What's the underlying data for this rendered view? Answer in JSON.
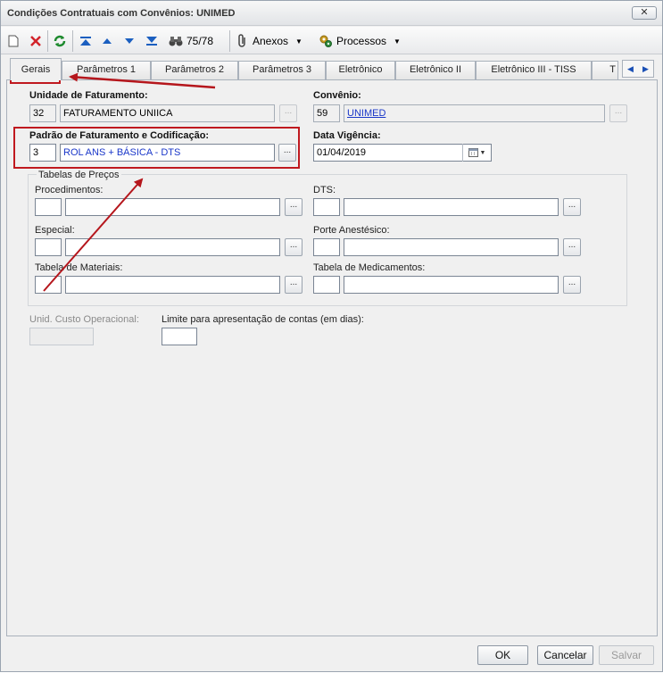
{
  "window": {
    "title": "Condições Contratuais com Convênios: UNIMED",
    "close_label": "✕"
  },
  "toolbar": {
    "record_counter": "75/78",
    "attachments_label": "Anexos",
    "processes_label": "Processos"
  },
  "tabs": [
    {
      "label": "Gerais",
      "active": true
    },
    {
      "label": "Parâmetros 1"
    },
    {
      "label": "Parâmetros 2"
    },
    {
      "label": "Parâmetros 3"
    },
    {
      "label": "Eletrônico"
    },
    {
      "label": "Eletrônico II"
    },
    {
      "label": "Eletrônico III - TISS"
    },
    {
      "label": "T"
    }
  ],
  "form": {
    "unidade": {
      "label": "Unidade de Faturamento:",
      "code": "32",
      "name": "FATURAMENTO UNIICA"
    },
    "convenio": {
      "label": "Convênio:",
      "code": "59",
      "name": "UNIMED"
    },
    "padrao": {
      "label": "Padrão de Faturamento e Codificação:",
      "code": "3",
      "name": "ROL ANS + BÁSICA - DTS"
    },
    "vigencia": {
      "label": "Data Vigência:",
      "value": "01/04/2019"
    },
    "tabelas": {
      "title": "Tabelas de Preços",
      "procedimentos": "Procedimentos:",
      "dts": "DTS:",
      "especial": "Especial:",
      "porte": "Porte Anestésico:",
      "materiais": "Tabela de Materiais:",
      "medicamentos": "Tabela de Medicamentos:"
    },
    "custo_label": "Unid. Custo Operacional:",
    "limite_label": "Limite para apresentação de contas (em dias):",
    "ellipsis": "..."
  },
  "footer": {
    "ok": "OK",
    "cancel": "Cancelar",
    "save": "Salvar"
  },
  "colors": {
    "highlight": "#c0191f",
    "link_blue": "#1a37c9",
    "arrow": "#b5161c"
  }
}
